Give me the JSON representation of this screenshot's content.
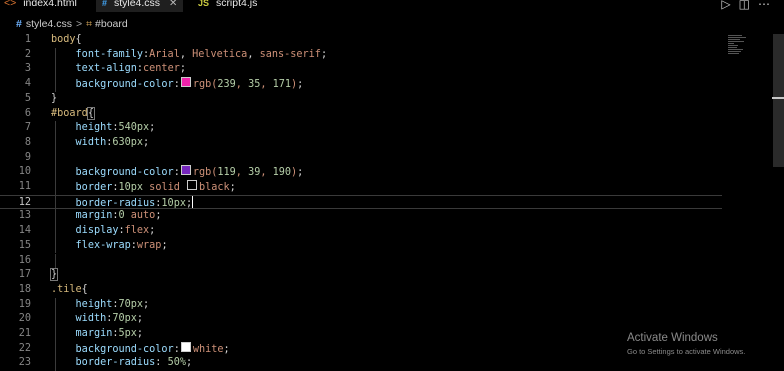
{
  "tabs": [
    {
      "name": "index4.html",
      "icon_text": "",
      "icon_color": "#e37933",
      "active": false
    },
    {
      "name": "style4.css",
      "icon_text": "#",
      "icon_color": "#42a5f5",
      "active": true
    },
    {
      "name": "script4.js",
      "icon_text": "JS",
      "icon_color": "#cbcb41",
      "active": false
    }
  ],
  "breadcrumb": {
    "file": "style4.css",
    "separator": ">",
    "symbol": "#board"
  },
  "editor": {
    "current_line": 12,
    "lines": [
      {
        "n": "1",
        "tokens": [
          {
            "t": "body",
            "c": "sel"
          },
          {
            "t": "{",
            "c": "brace"
          }
        ]
      },
      {
        "n": "2",
        "tokens": [
          {
            "t": "    ",
            "c": "punc"
          },
          {
            "t": "font-family",
            "c": "prop"
          },
          {
            "t": ":",
            "c": "punc"
          },
          {
            "t": "Arial",
            "c": "val"
          },
          {
            "t": ", ",
            "c": "punc"
          },
          {
            "t": "Helvetica",
            "c": "val"
          },
          {
            "t": ", ",
            "c": "punc"
          },
          {
            "t": "sans-serif",
            "c": "val"
          },
          {
            "t": ";",
            "c": "punc"
          }
        ]
      },
      {
        "n": "3",
        "tokens": [
          {
            "t": "    ",
            "c": "punc"
          },
          {
            "t": "text-align",
            "c": "prop"
          },
          {
            "t": ":",
            "c": "punc"
          },
          {
            "t": "center",
            "c": "val"
          },
          {
            "t": ";",
            "c": "punc"
          }
        ]
      },
      {
        "n": "4",
        "tokens": [
          {
            "t": "    ",
            "c": "punc"
          },
          {
            "t": "background-color",
            "c": "prop"
          },
          {
            "t": ":",
            "c": "punc"
          },
          {
            "swatch": "#ef23ab"
          },
          {
            "t": "rgb(",
            "c": "val"
          },
          {
            "t": "239",
            "c": "num"
          },
          {
            "t": ", ",
            "c": "val"
          },
          {
            "t": "35",
            "c": "num"
          },
          {
            "t": ", ",
            "c": "val"
          },
          {
            "t": "171",
            "c": "num"
          },
          {
            "t": ")",
            "c": "val"
          },
          {
            "t": ";",
            "c": "punc"
          }
        ]
      },
      {
        "n": "5",
        "tokens": [
          {
            "t": "}",
            "c": "brace"
          }
        ]
      },
      {
        "n": "6",
        "tokens": [
          {
            "t": "#board",
            "c": "sel"
          },
          {
            "t": "{",
            "c": "bracehl"
          }
        ]
      },
      {
        "n": "7",
        "tokens": [
          {
            "t": "    ",
            "c": "punc"
          },
          {
            "t": "height",
            "c": "prop"
          },
          {
            "t": ":",
            "c": "punc"
          },
          {
            "t": "540px",
            "c": "num"
          },
          {
            "t": ";",
            "c": "punc"
          }
        ]
      },
      {
        "n": "8",
        "tokens": [
          {
            "t": "    ",
            "c": "punc"
          },
          {
            "t": "width",
            "c": "prop"
          },
          {
            "t": ":",
            "c": "punc"
          },
          {
            "t": "630px",
            "c": "num"
          },
          {
            "t": ";",
            "c": "punc"
          }
        ]
      },
      {
        "n": "9",
        "tokens": []
      },
      {
        "n": "10",
        "tokens": [
          {
            "t": "    ",
            "c": "punc"
          },
          {
            "t": "background-color",
            "c": "prop"
          },
          {
            "t": ":",
            "c": "punc"
          },
          {
            "swatch": "#7727be"
          },
          {
            "t": "rgb(",
            "c": "val"
          },
          {
            "t": "119",
            "c": "num"
          },
          {
            "t": ", ",
            "c": "val"
          },
          {
            "t": "39",
            "c": "num"
          },
          {
            "t": ", ",
            "c": "val"
          },
          {
            "t": "190",
            "c": "num"
          },
          {
            "t": ")",
            "c": "val"
          },
          {
            "t": ";",
            "c": "punc"
          }
        ]
      },
      {
        "n": "11",
        "tokens": [
          {
            "t": "    ",
            "c": "punc"
          },
          {
            "t": "border",
            "c": "prop"
          },
          {
            "t": ":",
            "c": "punc"
          },
          {
            "t": "10px",
            "c": "num"
          },
          {
            "t": " solid ",
            "c": "val"
          },
          {
            "swatch": "#000000"
          },
          {
            "t": "black",
            "c": "val"
          },
          {
            "t": ";",
            "c": "punc"
          }
        ]
      },
      {
        "n": "12",
        "tokens": [
          {
            "t": "    ",
            "c": "punc"
          },
          {
            "t": "border-radius",
            "c": "prop"
          },
          {
            "t": ":",
            "c": "punc"
          },
          {
            "t": "10px",
            "c": "num"
          },
          {
            "t": ";",
            "c": "punc"
          },
          {
            "cursor": true
          }
        ]
      },
      {
        "n": "13",
        "tokens": [
          {
            "t": "    ",
            "c": "punc"
          },
          {
            "t": "margin",
            "c": "prop"
          },
          {
            "t": ":",
            "c": "punc"
          },
          {
            "t": "0",
            "c": "num"
          },
          {
            "t": " auto",
            "c": "val"
          },
          {
            "t": ";",
            "c": "punc"
          }
        ]
      },
      {
        "n": "14",
        "tokens": [
          {
            "t": "    ",
            "c": "punc"
          },
          {
            "t": "display",
            "c": "prop"
          },
          {
            "t": ":",
            "c": "punc"
          },
          {
            "t": "flex",
            "c": "val"
          },
          {
            "t": ";",
            "c": "punc"
          }
        ]
      },
      {
        "n": "15",
        "tokens": [
          {
            "t": "    ",
            "c": "punc"
          },
          {
            "t": "flex-wrap",
            "c": "prop"
          },
          {
            "t": ":",
            "c": "punc"
          },
          {
            "t": "wrap",
            "c": "val"
          },
          {
            "t": ";",
            "c": "punc"
          }
        ]
      },
      {
        "n": "16",
        "tokens": []
      },
      {
        "n": "17",
        "tokens": [
          {
            "t": "}",
            "c": "bracehl"
          }
        ]
      },
      {
        "n": "18",
        "tokens": [
          {
            "t": ".tile",
            "c": "sel"
          },
          {
            "t": "{",
            "c": "brace"
          }
        ]
      },
      {
        "n": "19",
        "tokens": [
          {
            "t": "    ",
            "c": "punc"
          },
          {
            "t": "height",
            "c": "prop"
          },
          {
            "t": ":",
            "c": "punc"
          },
          {
            "t": "70px",
            "c": "num"
          },
          {
            "t": ";",
            "c": "punc"
          }
        ]
      },
      {
        "n": "20",
        "tokens": [
          {
            "t": "    ",
            "c": "punc"
          },
          {
            "t": "width",
            "c": "prop"
          },
          {
            "t": ":",
            "c": "punc"
          },
          {
            "t": "70px",
            "c": "num"
          },
          {
            "t": ";",
            "c": "punc"
          }
        ]
      },
      {
        "n": "21",
        "tokens": [
          {
            "t": "    ",
            "c": "punc"
          },
          {
            "t": "margin",
            "c": "prop"
          },
          {
            "t": ":",
            "c": "punc"
          },
          {
            "t": "5px",
            "c": "num"
          },
          {
            "t": ";",
            "c": "punc"
          }
        ]
      },
      {
        "n": "22",
        "tokens": [
          {
            "t": "    ",
            "c": "punc"
          },
          {
            "t": "background-color",
            "c": "prop"
          },
          {
            "t": ":",
            "c": "punc"
          },
          {
            "swatch": "#ffffff"
          },
          {
            "t": "white",
            "c": "val"
          },
          {
            "t": ";",
            "c": "punc"
          }
        ]
      },
      {
        "n": "23",
        "tokens": [
          {
            "t": "    ",
            "c": "punc"
          },
          {
            "t": "border-radius",
            "c": "prop"
          },
          {
            "t": ": ",
            "c": "punc"
          },
          {
            "t": "50%",
            "c": "num"
          },
          {
            "t": ";",
            "c": "punc"
          }
        ]
      }
    ]
  },
  "watermark": {
    "title": "Activate Windows",
    "subtitle": "Go to Settings to activate Windows."
  },
  "icons": {
    "run": "play-icon",
    "split": "split-editor-icon",
    "more": "more-icon"
  }
}
